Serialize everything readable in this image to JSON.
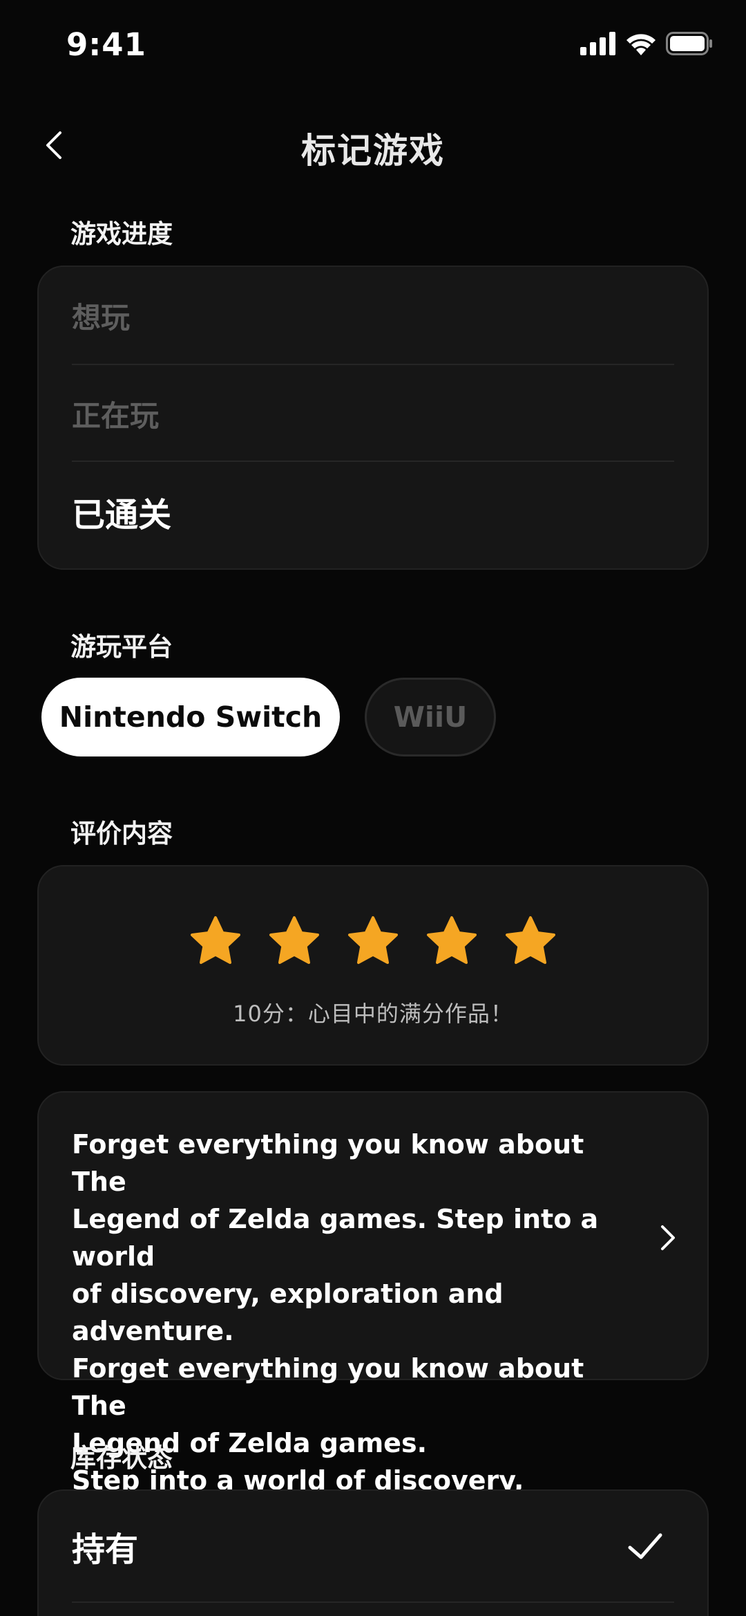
{
  "status_bar": {
    "time": "9:41"
  },
  "nav": {
    "title": "标记游戏"
  },
  "progress": {
    "label": "游戏进度",
    "options": [
      "想玩",
      "正在玩",
      "已通关"
    ],
    "selected": "已通关"
  },
  "platform": {
    "label": "游玩平台",
    "options": [
      "Nintendo Switch",
      "WiiU"
    ],
    "selected": "Nintendo Switch"
  },
  "review": {
    "label": "评价内容",
    "stars": 5,
    "max_stars": 5,
    "rating_text": "10分：心目中的满分作品！",
    "text": "Forget everything you know about The\nLegend of Zelda games. Step into a world\nof discovery, exploration and adventure.\nForget everything you know about The\nLegend of Zelda games.\nStep into a world of discovery, explorati..."
  },
  "stock": {
    "label": "库存状态",
    "options": [
      "持有"
    ],
    "selected": "持有"
  },
  "colors": {
    "background": "#070707",
    "card": "#161616",
    "star": "#F5A623",
    "dim_text": "#5e5e5e"
  },
  "icons": [
    "back-chevron-icon",
    "signal-icon",
    "wifi-icon",
    "battery-icon",
    "star-icon",
    "chevron-right-icon",
    "checkmark-icon"
  ]
}
